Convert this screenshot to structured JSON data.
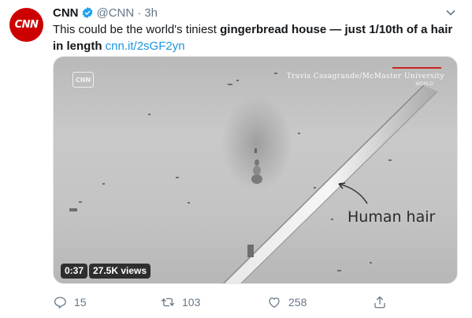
{
  "tweet": {
    "avatar_text": "CNN",
    "name": "CNN",
    "handle": "@CNN",
    "separator": "·",
    "time": "3h",
    "text_plain_1": "This could be the world's tiniest ",
    "text_bold": "gingerbread house — just 1/10th of a hair in length",
    "text_space": " ",
    "link": "cnn.it/2sGF2yn"
  },
  "media": {
    "watermark_logo": "CNN",
    "credit": "Travis Casagrande/McMaster University",
    "credit_sub": "WORLD",
    "annotation": "Human hair",
    "duration": "0:37",
    "views": "27.5K views"
  },
  "actions": {
    "replies": "15",
    "retweets": "103",
    "likes": "258"
  },
  "colors": {
    "brand": "#cc0000",
    "link": "#1b95e0",
    "muted": "#657786",
    "verified": "#1da1f2"
  },
  "icons": [
    "verified-badge-icon",
    "chevron-down-icon",
    "reply-icon",
    "retweet-icon",
    "like-icon",
    "share-icon"
  ]
}
